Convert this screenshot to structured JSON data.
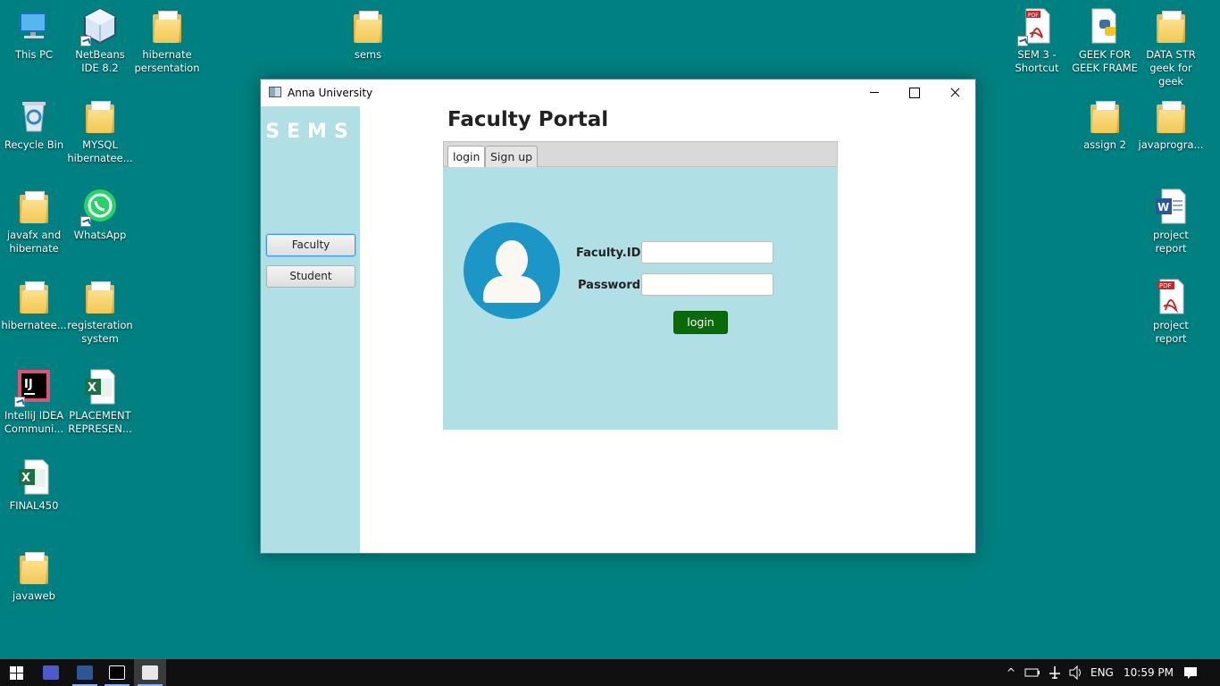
{
  "desktop": {
    "icons": [
      {
        "label": "This PC",
        "icon": "this-pc-icon"
      },
      {
        "label": "NetBeans IDE 8.2",
        "icon": "netbeans-icon"
      },
      {
        "label": "hibernate persentation",
        "icon": "folder-icon"
      },
      {
        "label": "sems",
        "icon": "folder-icon"
      },
      {
        "label": "SEM 3 - Shortcut",
        "icon": "pdf-icon"
      },
      {
        "label": "GEEK FOR GEEK FRAME",
        "icon": "python-file-icon"
      },
      {
        "label": "DATA STR geek for geek",
        "icon": "folder-icon"
      },
      {
        "label": "Recycle Bin",
        "icon": "recycle-bin-icon"
      },
      {
        "label": "MYSQL hibernatee...",
        "icon": "folder-icon"
      },
      {
        "label": "assign 2",
        "icon": "folder-icon"
      },
      {
        "label": "javaprogra...",
        "icon": "folder-icon"
      },
      {
        "label": "javafx and hibernate",
        "icon": "folder-icon"
      },
      {
        "label": "WhatsApp",
        "icon": "whatsapp-icon"
      },
      {
        "label": "project report",
        "icon": "word-icon"
      },
      {
        "label": "hibernatee...",
        "icon": "folder-icon"
      },
      {
        "label": "registeration system",
        "icon": "folder-icon"
      },
      {
        "label": "project report",
        "icon": "pdf-icon"
      },
      {
        "label": "IntelliJ IDEA Communi...",
        "icon": "intellij-icon"
      },
      {
        "label": "PLACEMENT REPRESEN...",
        "icon": "excel-icon"
      },
      {
        "label": "FINAL450",
        "icon": "excel-icon"
      },
      {
        "label": "javaweb",
        "icon": "folder-icon"
      }
    ]
  },
  "window": {
    "title": "Anna University",
    "sidebar": {
      "brand": "SEMS",
      "buttons": [
        "Faculty",
        "Student"
      ]
    },
    "heading": "Faculty Portal",
    "tabs": [
      "login",
      "Sign up"
    ],
    "form": {
      "id_label": "Faculty.ID",
      "id_value": "",
      "password_label": "Password",
      "password_value": "",
      "submit_label": "login",
      "submit_color": "#0a6a0a"
    }
  },
  "taskbar": {
    "apps": [
      "teams-icon",
      "word-icon",
      "intellij-icon",
      "java-icon"
    ],
    "language": "ENG",
    "time": "10:59 PM"
  },
  "colors": {
    "desktop": "#008080",
    "panel": "#b0dfe5",
    "avatar": "#1c96c7"
  }
}
